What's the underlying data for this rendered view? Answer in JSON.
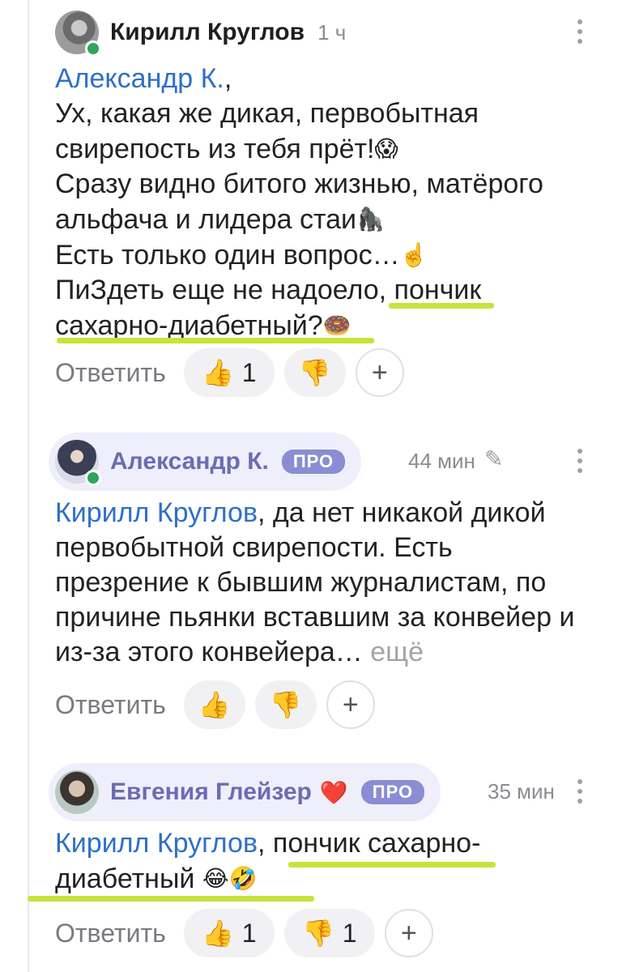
{
  "comments": [
    {
      "author": "Кирилл Круглов",
      "time": "1 ч",
      "online": true,
      "pro": false,
      "lines": [
        {
          "mention": "Александр К.",
          "text": ","
        },
        {
          "text": "Ух, какая же дикая, первобытная"
        },
        {
          "text": "свирепость из тебя прёт!",
          "emoji": "😱"
        },
        {
          "text": "Сразу видно битого жизнью, матёрого"
        },
        {
          "text": "альфача и лидера стаи",
          "emoji": "🦍"
        },
        {
          "text": "Есть только один вопрос…",
          "emoji": "☝️"
        },
        {
          "text": "ПиЗдеть еще не надоело, пончик"
        },
        {
          "text": "сахарно-диабетный?",
          "emoji": "🍩"
        }
      ],
      "reply_label": "Ответить",
      "like": {
        "icon": "👍",
        "count": "1"
      },
      "dislike": {
        "icon": "👎",
        "count": ""
      },
      "add_label": "+"
    },
    {
      "author": "Александр К.",
      "time": "44 мин",
      "edited_icon": "✎",
      "online": true,
      "pro": true,
      "pro_label": "ПРО",
      "lines": [
        {
          "mention": "Кирилл Круглов",
          "text": ", да нет никакой дикой"
        },
        {
          "text": "первобытной свирепости. Есть"
        },
        {
          "text": "презрение к бывшим журналистам, по"
        },
        {
          "text": "причине пьянки вставшим за конвейер и"
        },
        {
          "text": "из-за этого конвейера…",
          "more": "ещё"
        }
      ],
      "reply_label": "Ответить",
      "like": {
        "icon": "👍",
        "count": ""
      },
      "dislike": {
        "icon": "👎",
        "count": ""
      },
      "add_label": "+"
    },
    {
      "author": "Евгения Глейзер",
      "heart": "❤️",
      "time": "35 мин",
      "online": false,
      "pro": true,
      "pro_label": "ПРО",
      "lines": [
        {
          "mention": "Кирилл Круглов",
          "text": ", пончик сахарно-"
        },
        {
          "text": "диабетный",
          "emoji": "😂🤣"
        }
      ],
      "reply_label": "Ответить",
      "like": {
        "icon": "👍",
        "count": "1"
      },
      "dislike": {
        "icon": "👎",
        "count": "1"
      },
      "add_label": "+"
    }
  ],
  "colors": {
    "mention": "#2f6fc9",
    "underline": "#c6e33a",
    "pro_badge": "#8a8dd2",
    "online": "#2ea55a"
  }
}
